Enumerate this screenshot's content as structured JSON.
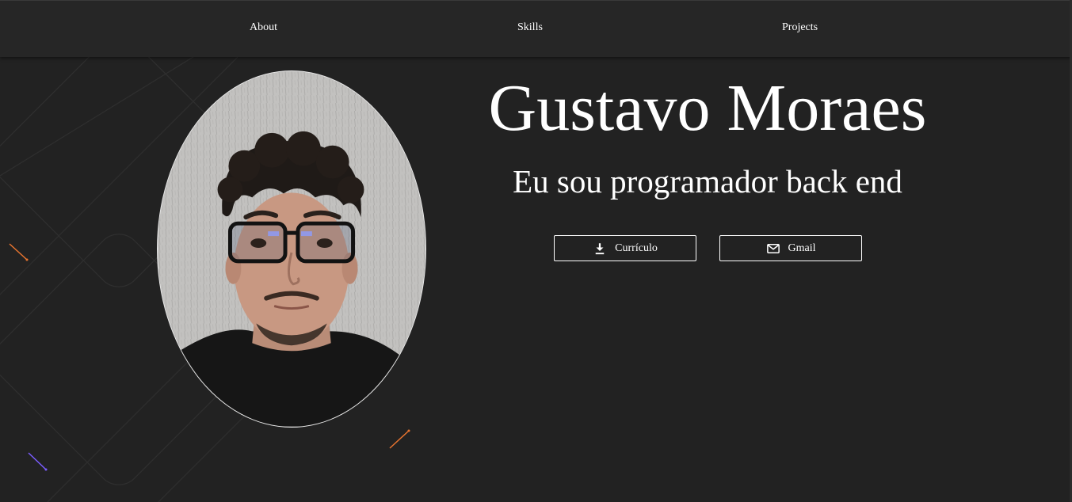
{
  "nav": {
    "items": [
      {
        "label": "About"
      },
      {
        "label": "Skills"
      },
      {
        "label": "Projects"
      }
    ]
  },
  "hero": {
    "name": "Gustavo Moraes",
    "subtitle": "Eu sou programador back end"
  },
  "buttons": {
    "resume": {
      "label": "Currículo",
      "icon": "download-icon"
    },
    "email": {
      "label": "Gmail",
      "icon": "mail-icon"
    }
  },
  "profile_photo": {
    "alt": "Gustavo Moraes"
  },
  "colors": {
    "background": "#222222",
    "nav_background": "#262626",
    "text": "#ffffff",
    "accent_orange": "#e8742f",
    "accent_purple": "#7a5cff"
  }
}
